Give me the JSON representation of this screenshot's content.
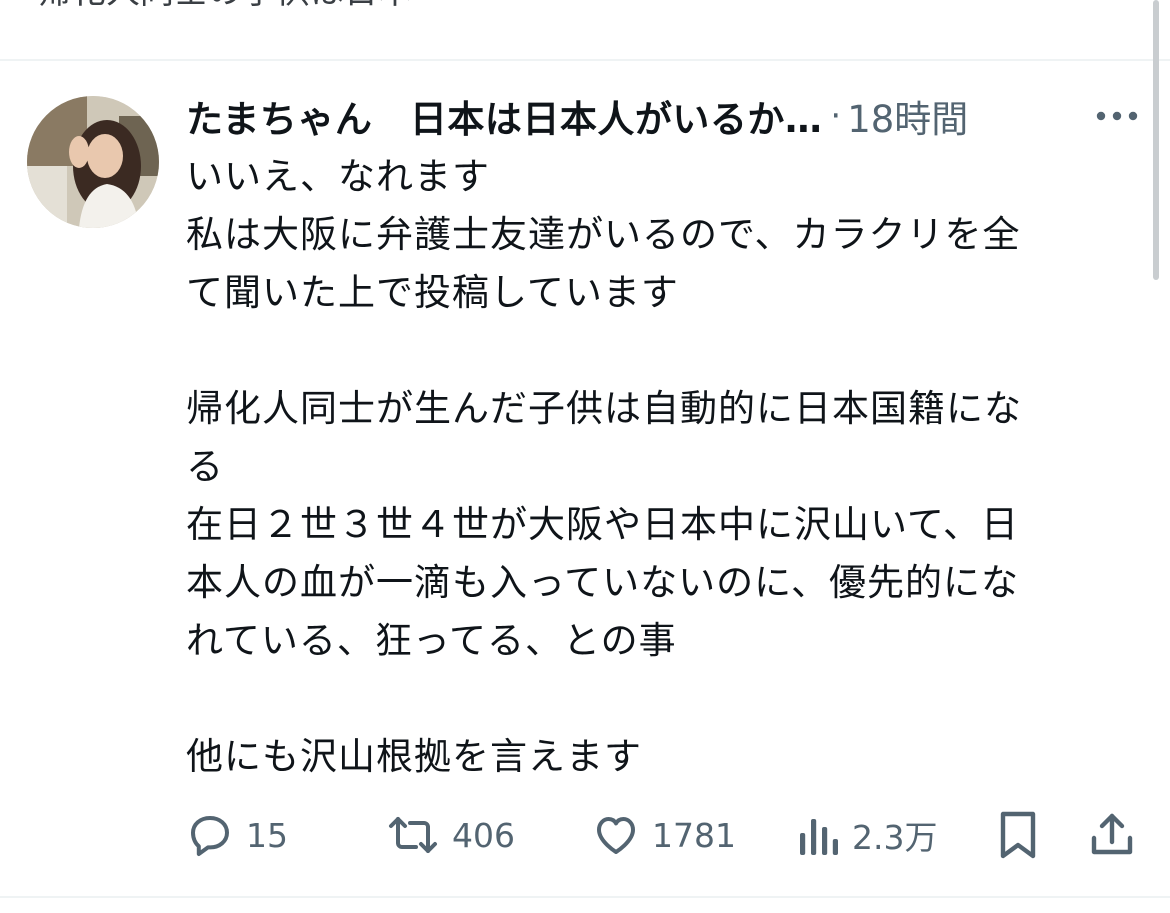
{
  "previous_post": {
    "tail_text": "帰化人同士の子供は日本"
  },
  "post": {
    "author_name": "たまちゃん　日本は日本人がいるか…",
    "separator": "·",
    "time": "18時間",
    "paragraphs": [
      "いいえ、なれます\n私は大阪に弁護士友達がいるので、カラクリを全\nて聞いた上で投稿しています",
      "帰化人同士が生んだ子供は自動的に日本国籍にな\nる\n在日２世３世４世が大阪や日本中に沢山いて、日\n本人の血が一滴も入っていないのに、優先的にな\nれている、狂ってる、との事",
      "他にも沢山根拠を言えます"
    ],
    "actions": {
      "reply_count": "15",
      "repost_count": "406",
      "like_count": "1781",
      "view_count": "2.3万"
    }
  },
  "icons": {
    "more": "more-horizontal-icon",
    "reply": "reply-bubble-icon",
    "repost": "repost-arrows-icon",
    "like": "heart-icon",
    "views": "bar-chart-icon",
    "bookmark": "bookmark-icon",
    "share": "share-upload-icon"
  },
  "colors": {
    "text_primary": "#0f1419",
    "text_secondary": "#536471",
    "divider": "#eff3f4"
  }
}
